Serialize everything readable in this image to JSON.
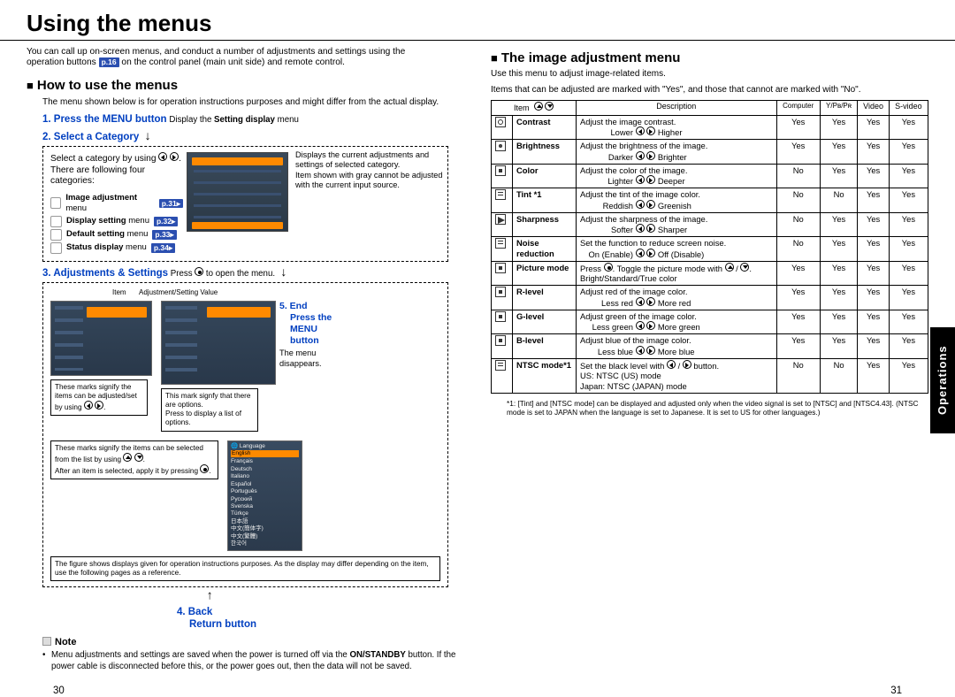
{
  "title": "Using the menus",
  "intro": "You can call up on-screen menus, and conduct a number of adjustments and settings using the operation buttons ",
  "intro2": " on the control panel (main unit side) and remote control.",
  "p16": "p.16",
  "left": {
    "h2": "How to use the menus",
    "sub": "The menu shown below is for operation instructions purposes and might differ from the actual display.",
    "step1": "1. Press the MENU button",
    "step1desc": " Display the ",
    "step1desc2": "Setting display",
    "step1desc3": " menu",
    "step2": "2. Select a Category",
    "selectLine": "Select a category by using ",
    "followLine": "There are following four categories:",
    "cats": [
      {
        "name": "Image adjustment",
        "suffix": " menu",
        "p": "p.31"
      },
      {
        "name": "Display setting",
        "suffix": " menu",
        "p": "p.32"
      },
      {
        "name": "Default setting",
        "suffix": " menu",
        "p": "p.33"
      },
      {
        "name": "Status display",
        "suffix": " menu",
        "p": "p.34"
      }
    ],
    "explain": "Displays the current adjustments and settings of selected category.\nItem shown with gray cannot be adjusted with the current input source.",
    "step3": "3. Adjustments & Settings",
    "step3desc": " Press ",
    "step3desc2": " to open the menu.",
    "itemLabel": "Item",
    "adjLabel": "Adjustment/Setting Value",
    "marks1": "These marks signify the items can be adjusted/set by using ",
    "marks2": "These marks signify the items can be selected from the list by using ",
    "marks2b": "After an item is selected, apply it by pressing ",
    "marks3": "This mark signfy that there are options.\nPress      to display a list of options.",
    "disclaimer": "The figure shows displays given for operation instructions purposes.  As the display may differ depending on the item, use the following pages as a reference.",
    "step4": "4. Back",
    "step4b": "Return button",
    "step5": "5. End",
    "step5b": "Press the MENU button",
    "step5c": "The menu disappears.",
    "noteHdr": "Note",
    "note": "Menu adjustments and settings are saved when the power is turned off via the ",
    "noteB1": "ON/STANDBY",
    "note2": " button. If the power cable is disconnected before this, or the power goes out, then the data will not be saved.",
    "pnum": "30"
  },
  "right": {
    "h2": "The image adjustment menu",
    "sub": "Use this menu to adjust image-related items.",
    "sub2": "Items that can be adjusted are marked with  \"Yes\", and those that cannot are marked with \"No\".",
    "headers": [
      "Item",
      "",
      "Description",
      "Computer",
      "Y/P",
      "Video",
      "S-video"
    ],
    "ypb": "Y/Pʙ/Pʀ",
    "rows": [
      {
        "item": "Contrast",
        "desc": "Adjust the image contrast.",
        "sub": "Lower",
        "sub2": "Higher",
        "c": "Yes",
        "y": "Yes",
        "v": "Yes",
        "s": "Yes"
      },
      {
        "item": "Brightness",
        "desc": "Adjust the brightness of the image.",
        "sub": "Darker",
        "sub2": "Brighter",
        "c": "Yes",
        "y": "Yes",
        "v": "Yes",
        "s": "Yes"
      },
      {
        "item": "Color",
        "desc": "Adjust the color of the image.",
        "sub": "Lighter",
        "sub2": "Deeper",
        "c": "No",
        "y": "Yes",
        "v": "Yes",
        "s": "Yes"
      },
      {
        "item": "Tint *1",
        "desc": "Adjust the tint of the image color.",
        "sub": "Reddish",
        "sub2": "Greenish",
        "c": "No",
        "y": "No",
        "v": "Yes",
        "s": "Yes"
      },
      {
        "item": "Sharpness",
        "desc": "Adjust the sharpness of the image.",
        "sub": "Softer",
        "sub2": "Sharper",
        "c": "No",
        "y": "Yes",
        "v": "Yes",
        "s": "Yes"
      },
      {
        "item": "Noise reduction",
        "desc": "Set the function to reduce screen noise.",
        "sub": "On (Enable)",
        "sub2": "Off (Disable)",
        "c": "No",
        "y": "Yes",
        "v": "Yes",
        "s": "Yes"
      },
      {
        "item": "Picture mode",
        "desc": "Press      . Toggle the picture mode with      /      .",
        "sub": "Bright/Standard/True color",
        "sub2": "",
        "c": "Yes",
        "y": "Yes",
        "v": "Yes",
        "s": "Yes",
        "pm": true
      },
      {
        "item": "R-level",
        "desc": "Adjust red of the image color.",
        "sub": "Less red",
        "sub2": "More red",
        "c": "Yes",
        "y": "Yes",
        "v": "Yes",
        "s": "Yes"
      },
      {
        "item": "G-level",
        "desc": "Adjust green of the image color.",
        "sub": "Less green",
        "sub2": "More green",
        "c": "Yes",
        "y": "Yes",
        "v": "Yes",
        "s": "Yes"
      },
      {
        "item": "B-level",
        "desc": "Adjust blue of the image color.",
        "sub": "Less blue",
        "sub2": "More blue",
        "c": "Yes",
        "y": "Yes",
        "v": "Yes",
        "s": "Yes"
      },
      {
        "item": "NTSC mode*1",
        "desc": "Set the black level with      /      button.",
        "sub": "US:     NTSC (US) mode",
        "sub2": "",
        "sub3": "Japan: NTSC (JAPAN) mode",
        "c": "No",
        "y": "No",
        "v": "Yes",
        "s": "Yes",
        "ntsc": true
      }
    ],
    "footnote": "*1: [Tint] and [NTSC mode] can be displayed and adjusted only when the video signal is set to [NTSC] and [NTSC4.43]. (NTSC mode is set to JAPAN when the language is set to Japanese. It is set to US for other languages.)",
    "pnum": "31"
  },
  "sidetab": "Operations"
}
